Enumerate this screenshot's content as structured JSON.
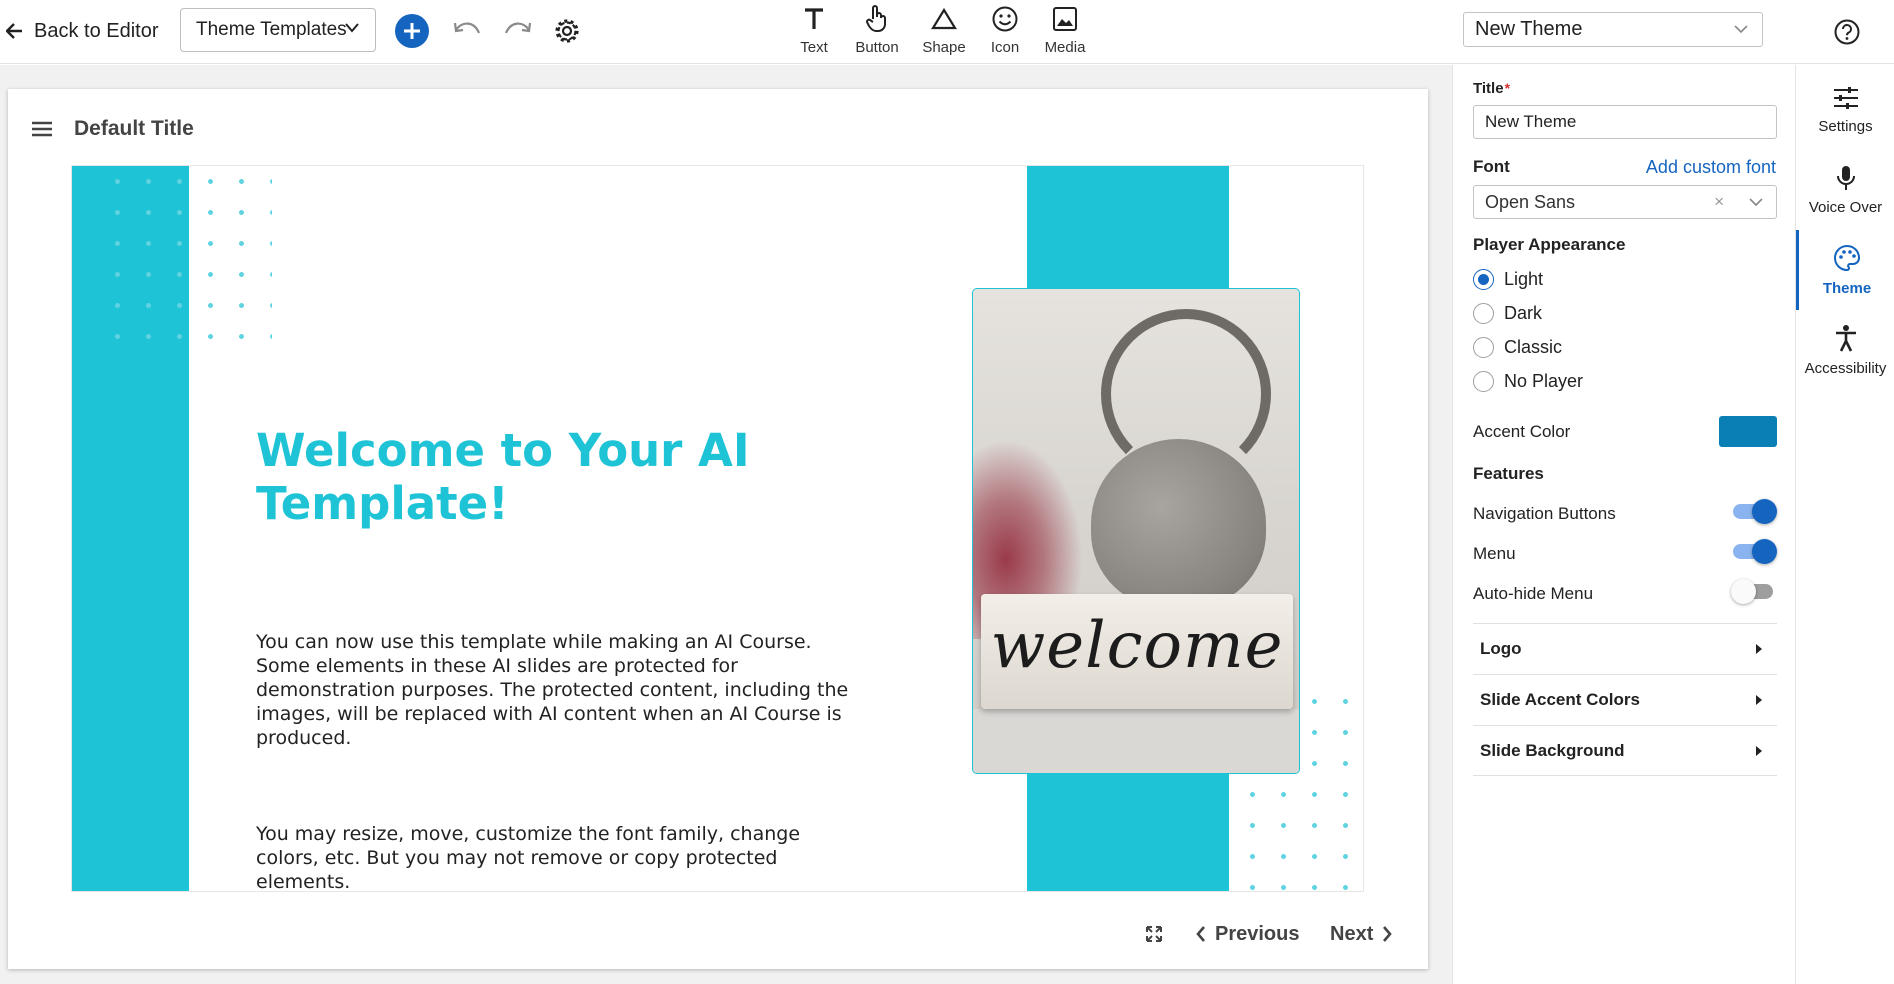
{
  "toolbar": {
    "back_label": "Back to Editor",
    "template_select": "Theme Templates",
    "tools": [
      {
        "label": "Text",
        "icon": "text-icon"
      },
      {
        "label": "Button",
        "icon": "pointer-hand-icon"
      },
      {
        "label": "Shape",
        "icon": "triangle-icon"
      },
      {
        "label": "Icon",
        "icon": "smiley-icon"
      },
      {
        "label": "Media",
        "icon": "image-icon"
      }
    ],
    "theme_select": "New Theme"
  },
  "card": {
    "title": "Default Title"
  },
  "slide": {
    "heading": "Welcome to Your AI Template!",
    "body_1": "You can now use this template while making an AI Course.\nSome elements in these AI slides are protected for\ndemonstration purposes. The protected content, including the\nimages, will be replaced with AI content when an AI Course is\nproduced.",
    "body_2": "You may resize, move, customize the font family, change\ncolors, etc. But you may not remove or copy protected\nelements.",
    "image_word": "welcome",
    "accent_color": "#1fc3d6"
  },
  "nav_controls": {
    "previous": "Previous",
    "next": "Next"
  },
  "panel": {
    "title_label": "Title",
    "title_required": "*",
    "title_value": "New Theme",
    "font_label": "Font",
    "add_font_link": "Add custom font",
    "font_value": "Open Sans",
    "font_clear": "×",
    "appearance_label": "Player Appearance",
    "appearance_options": [
      {
        "label": "Light",
        "selected": true
      },
      {
        "label": "Dark",
        "selected": false
      },
      {
        "label": "Classic",
        "selected": false
      },
      {
        "label": "No Player",
        "selected": false
      }
    ],
    "accent_label": "Accent Color",
    "accent_color": "#0a7fb5",
    "features_label": "Features",
    "features": [
      {
        "label": "Navigation Buttons",
        "on": true
      },
      {
        "label": "Menu",
        "on": true
      },
      {
        "label": "Auto-hide Menu",
        "on": false
      }
    ],
    "sections": [
      "Logo",
      "Slide Accent Colors",
      "Slide Background"
    ]
  },
  "sidenav": [
    {
      "label": "Settings",
      "icon": "sliders-icon",
      "active": false
    },
    {
      "label": "Voice Over",
      "icon": "microphone-icon",
      "active": false
    },
    {
      "label": "Theme",
      "icon": "palette-icon",
      "active": true
    },
    {
      "label": "Accessibility",
      "icon": "accessibility-icon",
      "active": false
    }
  ]
}
